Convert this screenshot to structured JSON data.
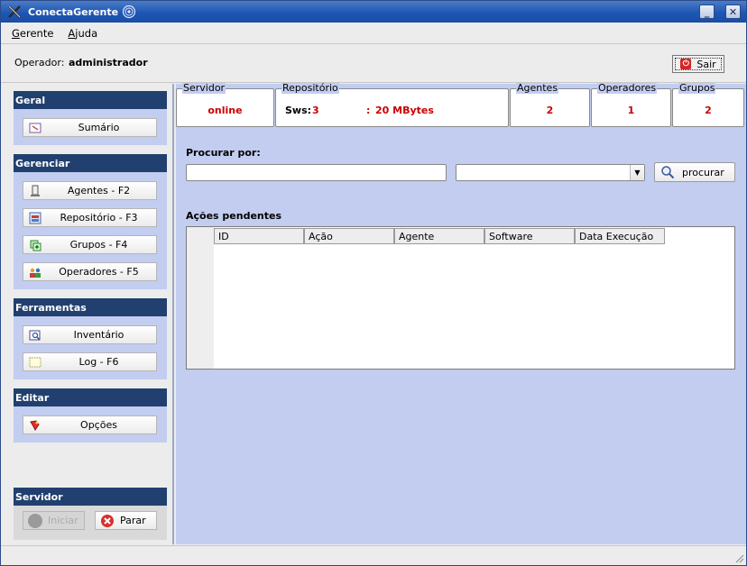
{
  "window": {
    "title": "ConectaGerente"
  },
  "menu": [
    {
      "label": "Gerente",
      "mnemonic": "G",
      "rest": "erente"
    },
    {
      "label": "Ajuda",
      "mnemonic": "A",
      "rest": "juda"
    }
  ],
  "operator": {
    "label": "Operador:",
    "value": "administrador",
    "exit_label": "Sair"
  },
  "sidebar": {
    "geral": {
      "header": "Geral",
      "items": [
        {
          "label": "Sumário",
          "icon": "summary-icon"
        }
      ]
    },
    "gerenciar": {
      "header": "Gerenciar",
      "items": [
        {
          "label": "Agentes - F2",
          "icon": "computer-icon"
        },
        {
          "label": "Repositório - F3",
          "icon": "repository-icon"
        },
        {
          "label": "Grupos - F4",
          "icon": "groups-icon"
        },
        {
          "label": "Operadores - F5",
          "icon": "operators-icon"
        }
      ]
    },
    "ferramentas": {
      "header": "Ferramentas",
      "items": [
        {
          "label": "Inventário",
          "icon": "inventory-icon"
        },
        {
          "label": "Log - F6",
          "icon": "log-icon"
        }
      ]
    },
    "editar": {
      "header": "Editar",
      "items": [
        {
          "label": "Opções",
          "icon": "options-icon"
        }
      ]
    },
    "servidor": {
      "header": "Servidor",
      "start_label": "Iniciar",
      "stop_label": "Parar"
    }
  },
  "stats": {
    "servidor": {
      "title": "Servidor",
      "value": "online"
    },
    "repositorio": {
      "title": "Repositório",
      "sws_label": "Sws:",
      "sws_value": "3",
      "size_sep": ":",
      "size_value": "20 MBytes"
    },
    "agentes": {
      "title": "Agentes",
      "value": "2"
    },
    "operadores": {
      "title": "Operadores",
      "value": "1"
    },
    "grupos": {
      "title": "Grupos",
      "value": "2"
    }
  },
  "search": {
    "label": "Procurar por:",
    "input_value": "",
    "select_value": "",
    "button_label": "procurar"
  },
  "pending": {
    "label": "Ações pendentes",
    "columns": [
      "ID",
      "Ação",
      "Agente",
      "Software",
      "Data Execução"
    ],
    "rows": []
  },
  "colors": {
    "accent_red": "#c80000",
    "panel_blue": "#c2cdf0",
    "header_navy": "#21406f"
  }
}
